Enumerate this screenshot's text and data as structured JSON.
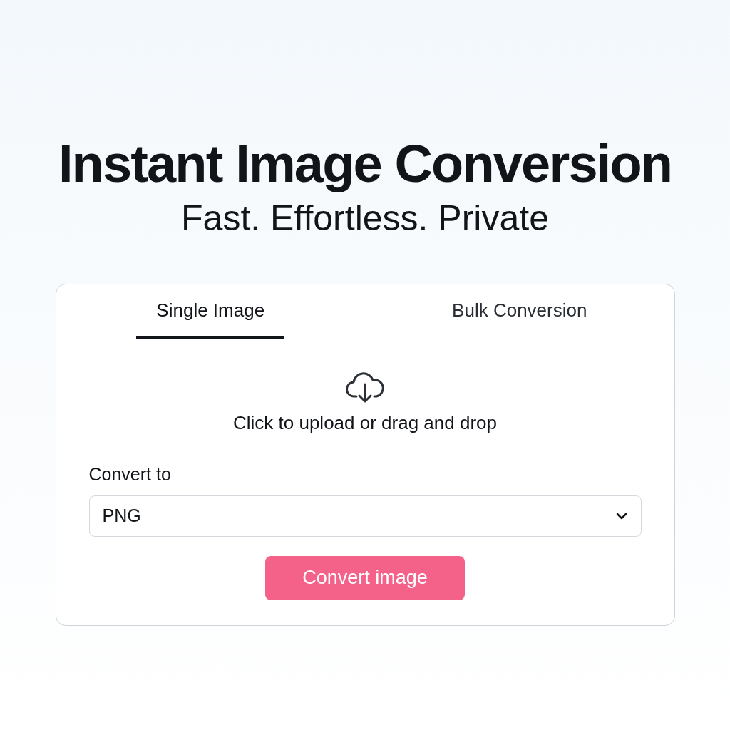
{
  "hero": {
    "title": "Instant Image Conversion",
    "subtitle": "Fast. Effortless. Private"
  },
  "tabs": [
    {
      "label": "Single Image",
      "selected": true
    },
    {
      "label": "Bulk Conversion",
      "selected": false
    }
  ],
  "upload": {
    "text": "Click to upload or drag and drop"
  },
  "format": {
    "label": "Convert to",
    "value": "PNG"
  },
  "button": {
    "label": "Convert image"
  }
}
